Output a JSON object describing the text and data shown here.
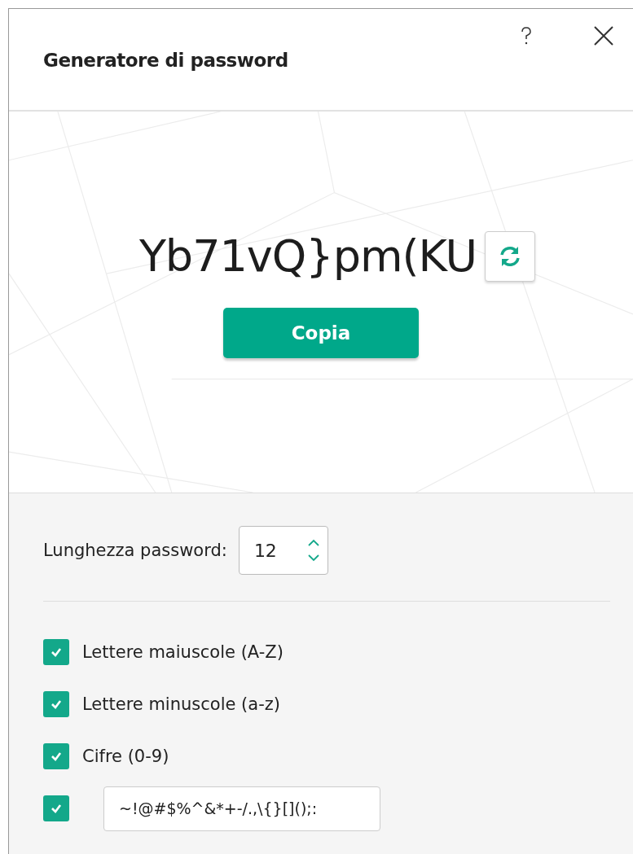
{
  "window": {
    "title": "Generatore di password"
  },
  "password": "Yb71vQ}pm(KU",
  "copy_button": "Copia",
  "length": {
    "label": "Lunghezza password:",
    "value": "12"
  },
  "options": [
    {
      "kind": "checkbox",
      "label": "Lettere maiuscole (A-Z)",
      "checked": true
    },
    {
      "kind": "checkbox",
      "label": "Lettere minuscole (a-z)",
      "checked": true
    },
    {
      "kind": "checkbox",
      "label": "Cifre (0-9)",
      "checked": true
    },
    {
      "kind": "field",
      "value": "~!@#$%^&*+-/.,\\{}[]();:",
      "checked": true
    }
  ]
}
